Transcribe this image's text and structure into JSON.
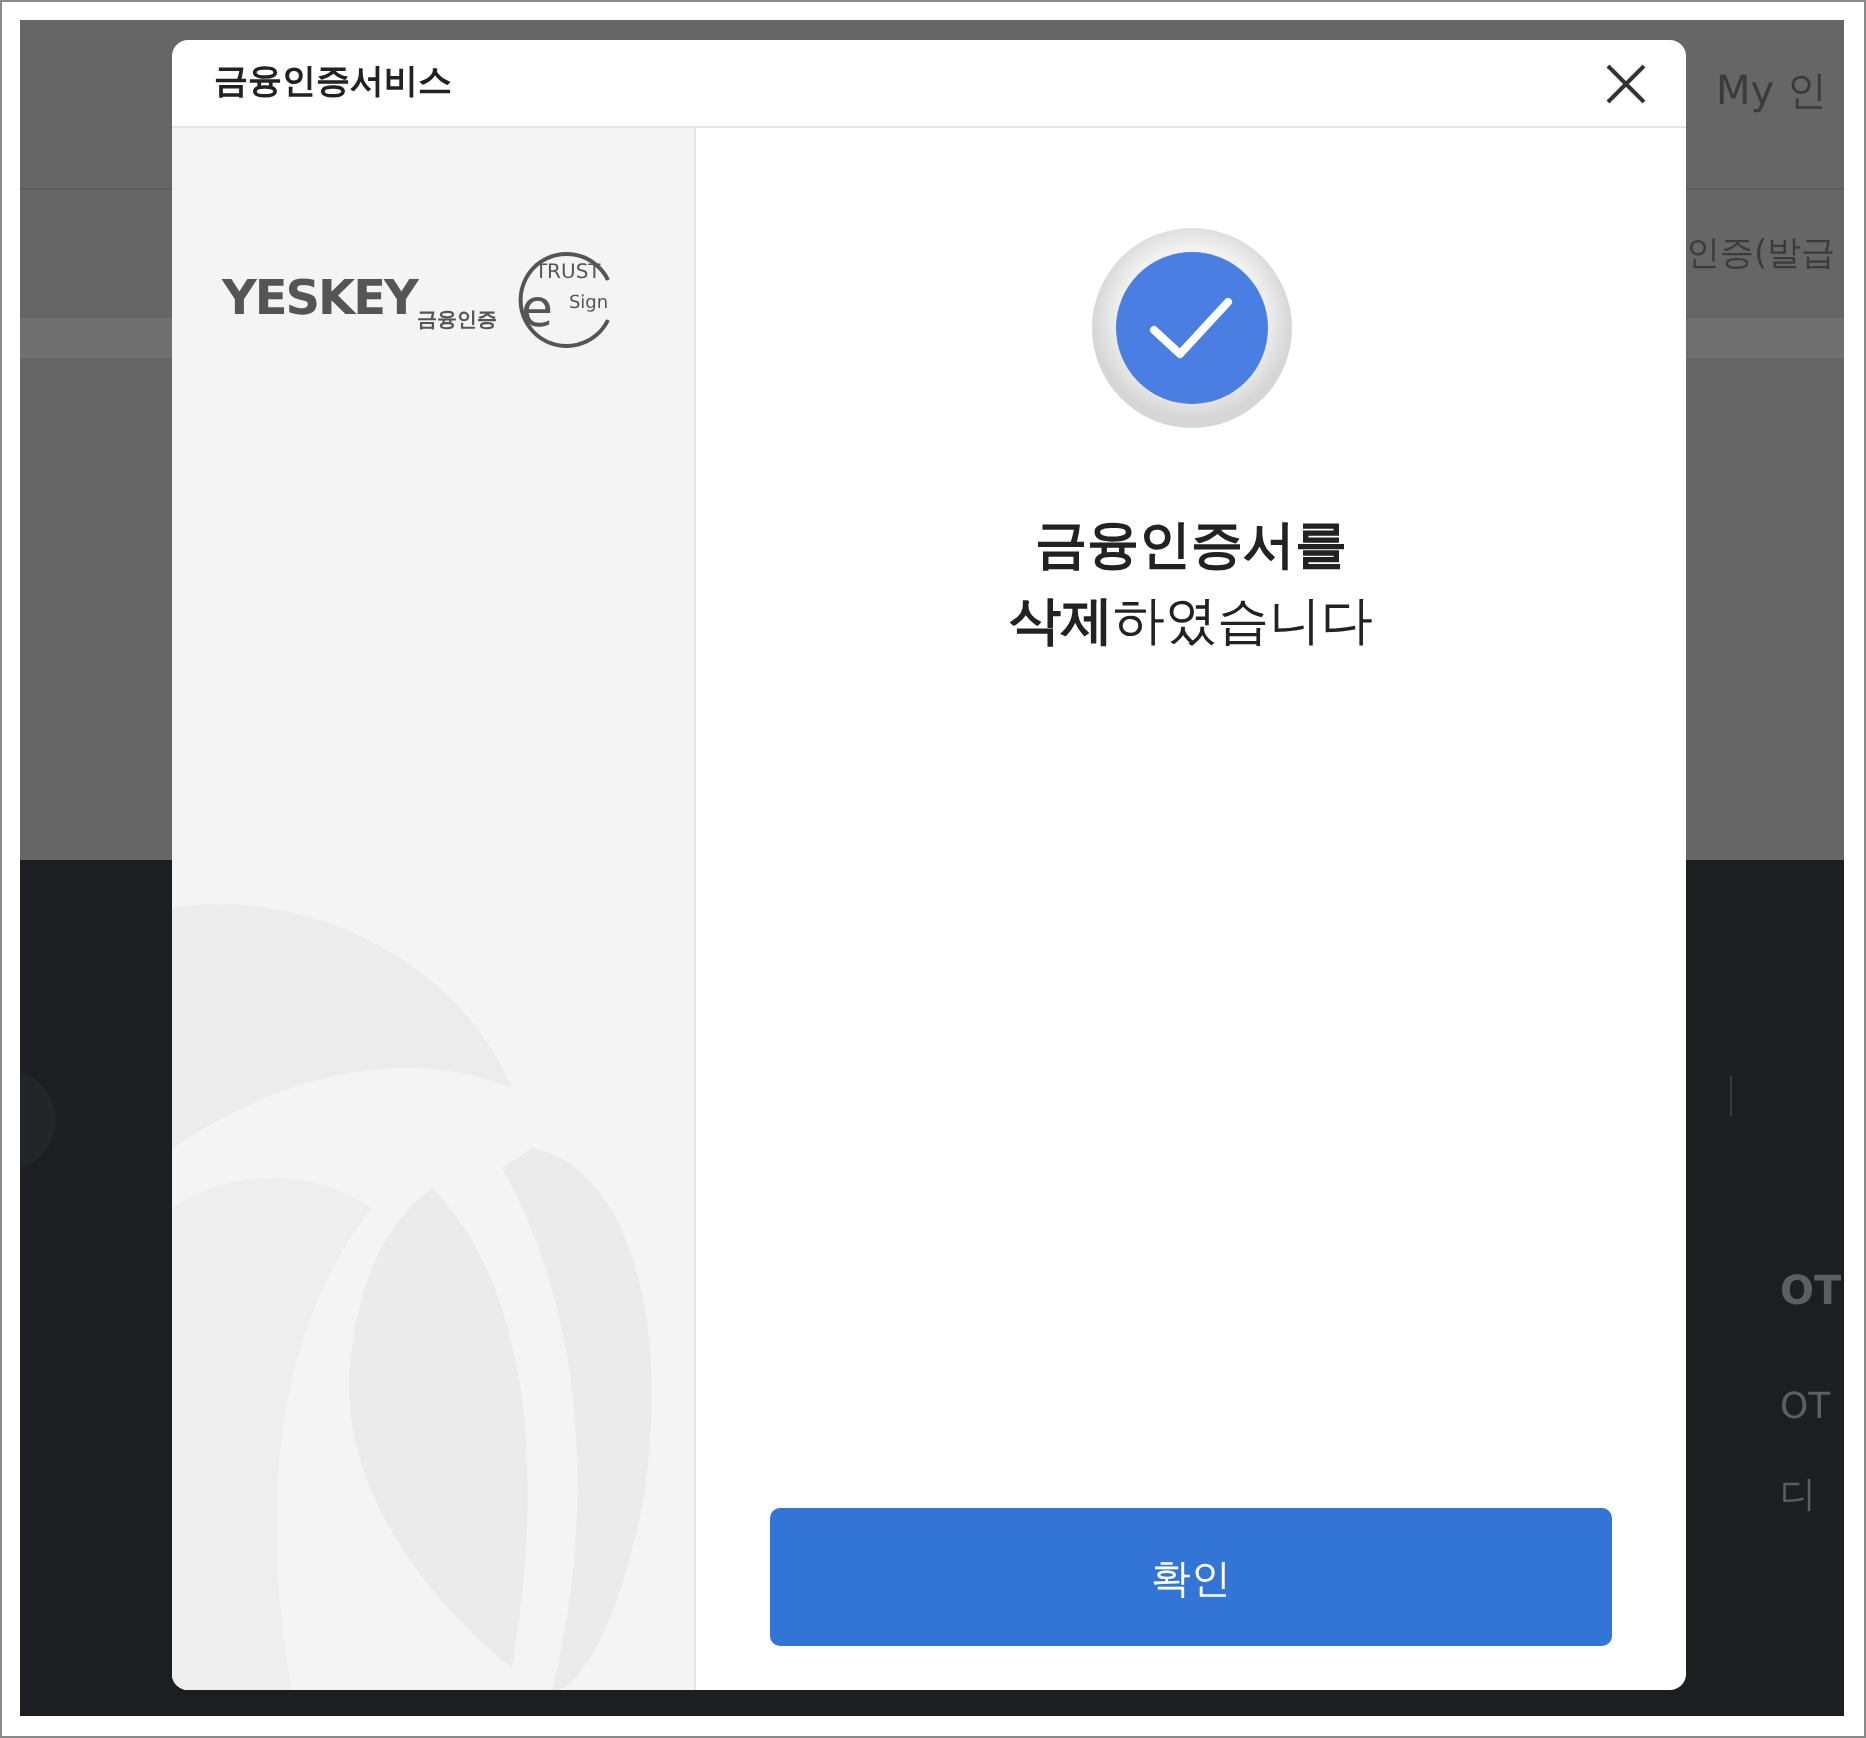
{
  "background_page": {
    "header_link": "My 인",
    "menu_text": "인증(발급",
    "footer_heading": "OT",
    "footer_lines": [
      "OT",
      "디"
    ]
  },
  "dialog": {
    "title": "금융인증서비스",
    "logo": {
      "wordmark": "YESKEY",
      "wordmark_sub": "금융인증",
      "seal_top": "TRUST",
      "seal_letter": "e",
      "seal_side": "Sign"
    },
    "message": "**금융인증서를**\n**삭제**하였습니다",
    "confirm_button": "확인"
  }
}
